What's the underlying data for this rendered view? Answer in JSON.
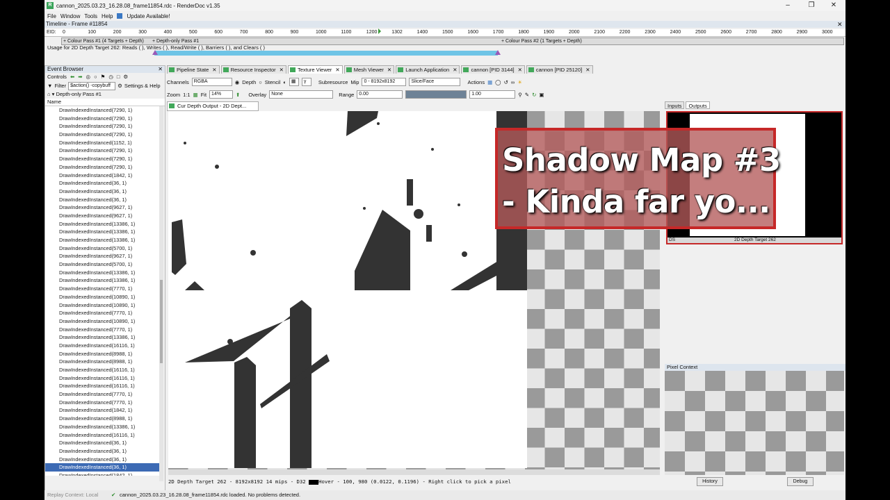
{
  "window": {
    "title": "cannon_2025.03.23_16.28.08_frame11854.rdc - RenderDoc v1.35",
    "minimize_icon": "minimize-icon",
    "maximize_icon": "maximize-icon",
    "close_icon": "close-icon"
  },
  "menu": {
    "file": "File",
    "window": "Window",
    "tools": "Tools",
    "help": "Help",
    "update": "Update Available!"
  },
  "timeline": {
    "title": "Timeline - Frame #11854",
    "eid_label": "EID:",
    "ticks": [
      "0",
      "100",
      "200",
      "300",
      "400",
      "500",
      "600",
      "700",
      "800",
      "900",
      "1000",
      "1100",
      "1200",
      "1302",
      "1400",
      "1500",
      "1600",
      "1700",
      "1800",
      "1900",
      "2000",
      "2100",
      "2200",
      "2300",
      "2400",
      "2500",
      "2600",
      "2700",
      "2800",
      "2900",
      "3000"
    ],
    "pass1": "+ Colour Pass #1 (4 Targets + Depth)",
    "pass2": "+ Depth-only Pass #1",
    "pass3": "+ Colour Pass #2 (1 Targets + Depth)",
    "usage": "Usage for 2D Depth Target 262: Reads ( ), Writes ( ), Read/Write ( ), Barriers ( ), and Clears ( )"
  },
  "event_browser": {
    "title": "Event Browser",
    "controls_label": "Controls",
    "filter_label": "Filter",
    "filter_value": "$action() -copybuff",
    "settings_label": "Settings & Help",
    "pass_label": "Depth-only Pass #1",
    "column_name": "Name",
    "items": [
      "DrawIndexedInstanced(7290, 1)",
      "DrawIndexedInstanced(7290, 1)",
      "DrawIndexedInstanced(7290, 1)",
      "DrawIndexedInstanced(7290, 1)",
      "DrawIndexedInstanced(1152, 1)",
      "DrawIndexedInstanced(7290, 1)",
      "DrawIndexedInstanced(7290, 1)",
      "DrawIndexedInstanced(7290, 1)",
      "DrawIndexedInstanced(1842, 1)",
      "DrawIndexedInstanced(36, 1)",
      "DrawIndexedInstanced(36, 1)",
      "DrawIndexedInstanced(36, 1)",
      "DrawIndexedInstanced(9627, 1)",
      "DrawIndexedInstanced(9627, 1)",
      "DrawIndexedInstanced(13386, 1)",
      "DrawIndexedInstanced(13386, 1)",
      "DrawIndexedInstanced(13386, 1)",
      "DrawIndexedInstanced(5700, 1)",
      "DrawIndexedInstanced(9627, 1)",
      "DrawIndexedInstanced(5700, 1)",
      "DrawIndexedInstanced(13386, 1)",
      "DrawIndexedInstanced(13386, 1)",
      "DrawIndexedInstanced(7770, 1)",
      "DrawIndexedInstanced(10890, 1)",
      "DrawIndexedInstanced(10890, 1)",
      "DrawIndexedInstanced(7770, 1)",
      "DrawIndexedInstanced(10890, 1)",
      "DrawIndexedInstanced(7770, 1)",
      "DrawIndexedInstanced(13386, 1)",
      "DrawIndexedInstanced(16116, 1)",
      "DrawIndexedInstanced(8988, 1)",
      "DrawIndexedInstanced(8988, 1)",
      "DrawIndexedInstanced(16116, 1)",
      "DrawIndexedInstanced(16116, 1)",
      "DrawIndexedInstanced(16116, 1)",
      "DrawIndexedInstanced(7770, 1)",
      "DrawIndexedInstanced(7770, 1)",
      "DrawIndexedInstanced(1842, 1)",
      "DrawIndexedInstanced(8988, 1)",
      "DrawIndexedInstanced(13386, 1)",
      "DrawIndexedInstanced(16116, 1)",
      "DrawIndexedInstanced(36, 1)",
      "DrawIndexedInstanced(36, 1)",
      "DrawIndexedInstanced(36, 1)",
      "DrawIndexedInstanced(36, 1)",
      "DrawIndexedInstanced(1842, 1)"
    ],
    "selected_index": 44
  },
  "tabs": [
    "Pipeline State",
    "Resource Inspector",
    "Texture Viewer",
    "Mesh Viewer",
    "Launch Application",
    "cannon [PID 3144]",
    "cannon [PID 25120]"
  ],
  "active_tab": 2,
  "toolbar1": {
    "channels_label": "Channels",
    "channels_value": "RGBA",
    "depth_label": "Depth",
    "stencil_label": "Stencil",
    "subresource_label": "Subresource",
    "mip_label": "Mip",
    "mip_value": "0 - 8192x8192",
    "slice_label": "Slice/Face",
    "actions_label": "Actions"
  },
  "toolbar2": {
    "zoom_label": "Zoom",
    "zoom_1to1": "1:1",
    "fit_label": "Fit",
    "zoom_value": "14%",
    "overlay_label": "Overlay",
    "overlay_value": "None",
    "range_label": "Range",
    "range_min": "0.00",
    "range_max": "1.00"
  },
  "viewer_tab": "Cur Depth Output - 2D Dept...",
  "status_line": "2D Depth Target 262 - 8192x8192 14 mips - D32 ",
  "status_hover": "Hover -  100,  980 (0.0122, 0.1196)  - Right click to pick a pixel",
  "right_panel": {
    "inputs_tab": "Inputs",
    "outputs_tab": "Outputs",
    "thumb_label": "2D Depth Target 262",
    "thumb_ds": "DS",
    "pixel_context": "Pixel Context",
    "history_button": "History",
    "debug_button": "Debug"
  },
  "bottom_bar": {
    "replay": "Replay Context: Local",
    "message": "cannon_2025.03.23_16.28.08_frame11854.rdc loaded. No problems detected."
  },
  "overlay": {
    "line1": "Shadow Map #3",
    "line2": "- Kinda far yo..."
  }
}
